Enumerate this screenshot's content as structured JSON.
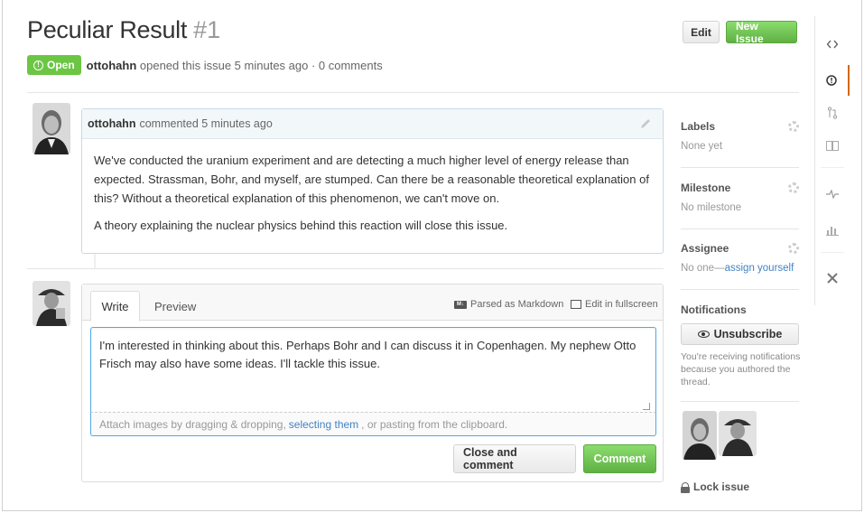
{
  "issue": {
    "title": "Peculiar Result",
    "number": "#1",
    "state": "Open",
    "author": "ottohahn",
    "meta": "opened this issue 5 minutes ago · 0 comments"
  },
  "header_buttons": {
    "edit": "Edit",
    "new_issue": "New Issue"
  },
  "comment": {
    "author": "ottohahn",
    "meta": "commented 5 minutes ago",
    "paragraphs": [
      "We've conducted the uranium experiment and are detecting a much higher level of energy release than expected. Strassman, Bohr, and myself, are stumped. Can there be a reasonable theoretical explanation of this? Without a theoretical explanation of this phenomenon, we can't move on.",
      "A theory explaining the nuclear physics behind this reaction will close this issue."
    ]
  },
  "composer": {
    "tabs": [
      "Write",
      "Preview"
    ],
    "markdown_hint": "Parsed as Markdown",
    "fullscreen": "Edit in fullscreen",
    "text": "I'm interested in thinking about this. Perhaps Bohr and I can discuss it in Copenhagen. My nephew Otto Frisch may also have some ideas. I'll tackle this issue.",
    "attach_before": "Attach images by dragging & dropping,",
    "attach_link": "selecting them",
    "attach_after": ", or pasting from the clipboard.",
    "close_button": "Close and comment",
    "comment_button": "Comment"
  },
  "sidebar": {
    "labels_title": "Labels",
    "labels_value": "None yet",
    "milestone_title": "Milestone",
    "milestone_value": "No milestone",
    "assignee_title": "Assignee",
    "assignee_value": "No one—",
    "assignee_link": "assign yourself",
    "notifications_title": "Notifications",
    "unsubscribe": "Unsubscribe",
    "notifications_text": "You're receiving notifications because you authored the thread.",
    "lock": "Lock issue"
  },
  "right_nav": [
    "code-icon",
    "issues-icon",
    "pull-request-icon",
    "wiki-icon",
    "pulse-icon",
    "graphs-icon",
    "settings-icon"
  ],
  "colors": {
    "green": "#6cc644",
    "link": "#4183c4",
    "active_nav": "#d26911"
  }
}
